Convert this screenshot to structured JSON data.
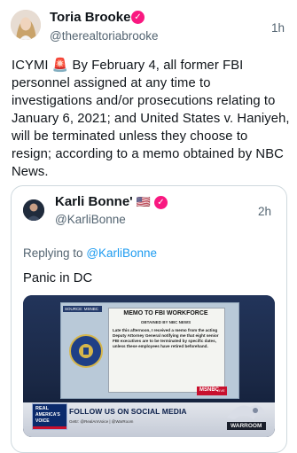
{
  "tweet": {
    "author_name": "Toria Brooke",
    "author_handle": "@therealtoriabrooke",
    "time": "1h",
    "text": "ICYMI 🚨 By February 4, all former FBI personnel assigned at any time to investigations and/or prosecutions relating to January 6, 2021; and United States v. Haniyeh, will be terminated unless they choose to resign; according to a memo obtained by NBC News."
  },
  "quote": {
    "author_name": "Karli Bonne'",
    "flag": "🇺🇸",
    "author_handle": "@KarliBonne",
    "time": "2h",
    "replying_label": "Replying to",
    "replying_handle": "@KarliBonne",
    "text": "Panic in DC"
  },
  "media": {
    "screen_tag": "SOURCE: MSNBC",
    "memo_title": "MEMO TO FBI WORKFORCE",
    "memo_subtitle": "OBTAINED BY NBC NEWS",
    "memo_body": "Late this afternoon, I received a memo from the acting Deputy Attorney General notifying me that eight senior FBI executives are to be terminated by specific dates, unless these employees have retired beforehand.",
    "network": "MSNBC",
    "network_sub": "LIVE",
    "banner_left_line1": "REAL",
    "banner_left_line2": "AMERICA'S",
    "banner_left_line3": "VOICE",
    "banner_text": "FOLLOW US ON SOCIAL MEDIA",
    "banner_sub": "Gettr: @RealAmVoice | @WarRoom",
    "logo_text": "WARROOM",
    "colors": {
      "banner": "#d7dbe4",
      "banner_text": "#0b1f4a",
      "msnbc_red": "#c8102e"
    }
  }
}
